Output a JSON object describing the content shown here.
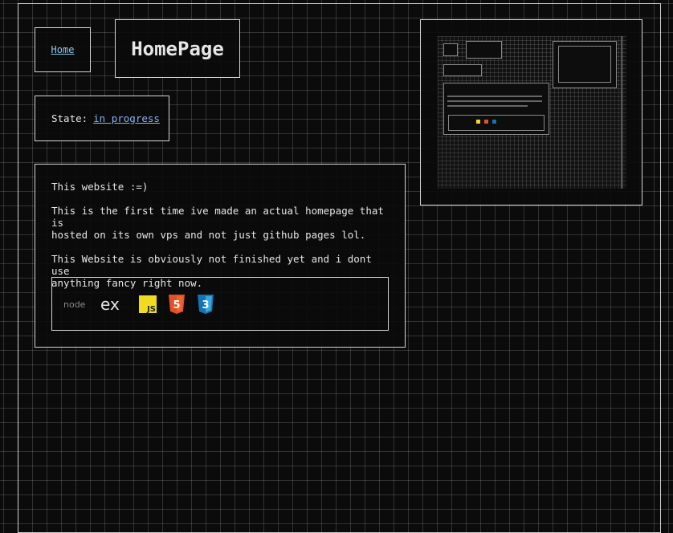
{
  "nav": {
    "home_label": "Home"
  },
  "header": {
    "title": "HomePage"
  },
  "state": {
    "label": "State:",
    "value": "in progress"
  },
  "about": {
    "heading": "This website :=)",
    "paragraph1": "This is the first time ive made an actual homepage that is\nhosted on its own vps and not just github pages lol.",
    "paragraph2": "This Website is obviously not finished yet and i dont use\nanything fancy right now."
  },
  "tech_icons": [
    {
      "name": "nodejs-icon",
      "label": "node"
    },
    {
      "name": "express-icon",
      "label": "ex"
    },
    {
      "name": "javascript-icon",
      "label": "JS"
    },
    {
      "name": "html5-icon",
      "label": "5"
    },
    {
      "name": "css3-icon",
      "label": "3"
    }
  ],
  "colors": {
    "link": "#8db1f5",
    "js": "#f0db1f",
    "html5": "#e34f26",
    "css3": "#1572b6",
    "node": "#6cc24a"
  }
}
